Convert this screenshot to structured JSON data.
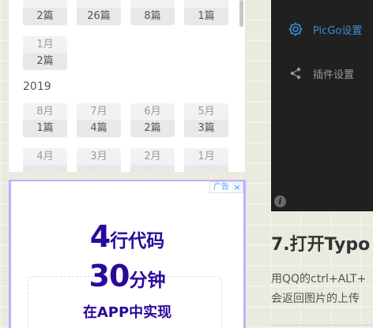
{
  "archive": {
    "top_row": [
      {
        "month": "",
        "count": "2篇"
      },
      {
        "month": "",
        "count": "26篇"
      },
      {
        "month": "",
        "count": "8篇"
      },
      {
        "month": "",
        "count": "1篇"
      }
    ],
    "single_row": [
      {
        "month": "1月",
        "count": "2篇"
      }
    ],
    "year": "2019",
    "row_2019_a": [
      {
        "month": "8月",
        "count": "1篇"
      },
      {
        "month": "7月",
        "count": "4篇"
      },
      {
        "month": "6月",
        "count": "2篇"
      },
      {
        "month": "5月",
        "count": "3篇"
      }
    ],
    "row_2019_b": [
      {
        "month": "4月",
        "count": ""
      },
      {
        "month": "3月",
        "count": ""
      },
      {
        "month": "2月",
        "count": ""
      },
      {
        "month": "1月",
        "count": ""
      }
    ]
  },
  "ad": {
    "tag": "广告",
    "close": "×",
    "line1_num": "4",
    "line1_txt": "行代码",
    "line2_num": "30",
    "line2_txt": "分钟",
    "line3": "在APP中实现"
  },
  "settings_menu": {
    "active_label": "PicGo设置",
    "active_icon": "gear-icon",
    "plugin_label": "插件设置",
    "plugin_icon": "share-icon",
    "accent_color": "#3a8bd6"
  },
  "article": {
    "heading": "7.打开Typo",
    "para_line1": "用QQ的ctrl+ALT+",
    "para_line2": "会返回图片的上传"
  }
}
